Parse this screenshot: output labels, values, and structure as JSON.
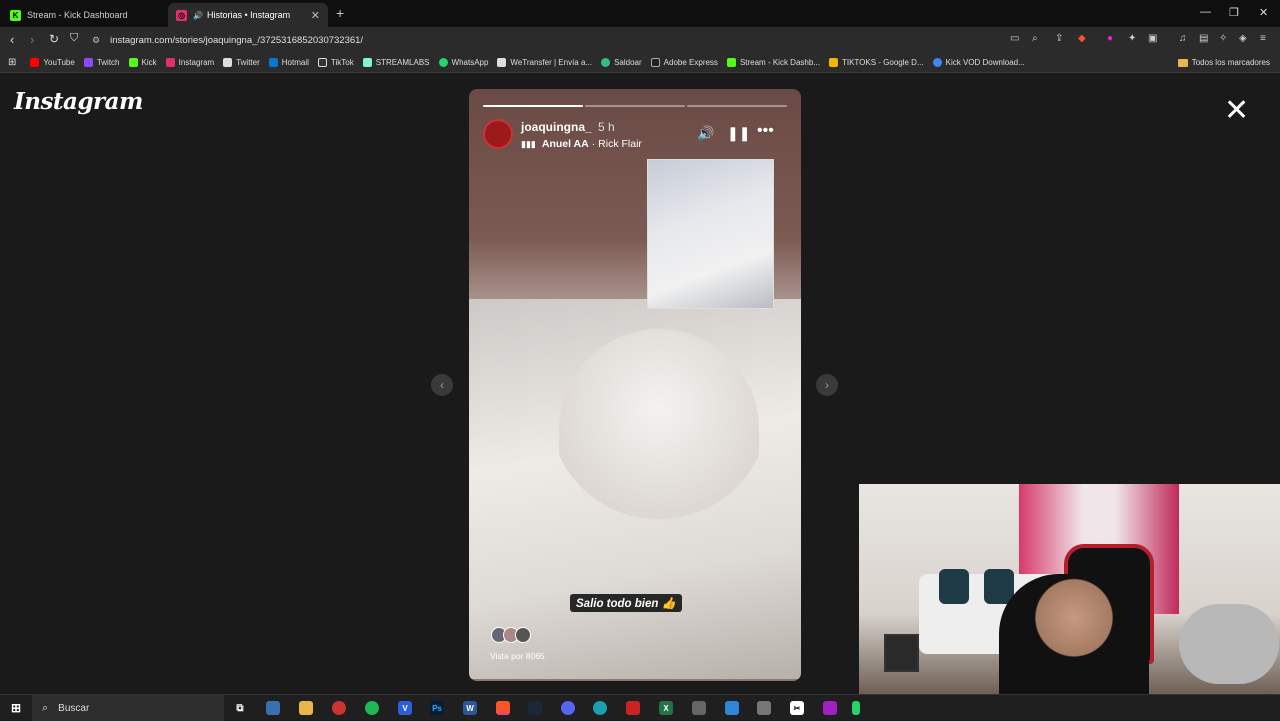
{
  "tabs": [
    {
      "title": "Stream - Kick Dashboard",
      "icon": "kick-icon"
    },
    {
      "title": "Historias • Instagram",
      "icon": "instagram-icon",
      "active": true
    }
  ],
  "address": {
    "url": "instagram.com/stories/joaquingna_/3725316852030732361/"
  },
  "bookmarks": [
    {
      "label": "YouTube",
      "color": "#ff0000"
    },
    {
      "label": "Twitch",
      "color": "#9146ff"
    },
    {
      "label": "Kick",
      "color": "#53fc18"
    },
    {
      "label": "Instagram",
      "color": "#e1306c"
    },
    {
      "label": "Twitter",
      "color": "#ffffff"
    },
    {
      "label": "Hotmail",
      "color": "#0078d4"
    },
    {
      "label": "TikTok",
      "color": "#ffffff"
    },
    {
      "label": "STREAMLABS",
      "color": "#80f5d2"
    },
    {
      "label": "WhatsApp",
      "color": "#25d366"
    },
    {
      "label": "WeTransfer | Envía a...",
      "color": "#ffffff"
    },
    {
      "label": "Saldoar",
      "color": "#2ec27e"
    },
    {
      "label": "Adobe Express",
      "color": "#ffffff"
    },
    {
      "label": "Stream - Kick Dashb...",
      "color": "#53fc18"
    },
    {
      "label": "TIKTOKS - Google D...",
      "color": "#f4b400"
    },
    {
      "label": "Kick VOD Download...",
      "color": "#4285f4"
    }
  ],
  "bookmarks_all": "Todos los marcadores",
  "page": {
    "logo": "Instagram"
  },
  "story": {
    "username": "joaquingna_",
    "time": "5 h",
    "song_artist": "Anuel AA",
    "song_title": "· Rick Flair",
    "caption": "Salio todo bien 👍",
    "views": "Vista por 8065",
    "progress": [
      1.0,
      0.0,
      0.0
    ]
  },
  "taskbar": {
    "search_placeholder": "Buscar"
  }
}
